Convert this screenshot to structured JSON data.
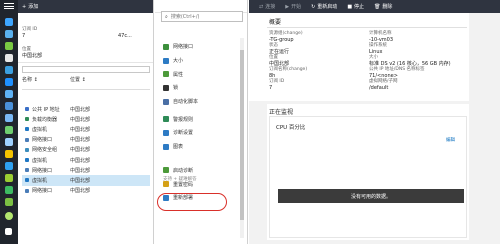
{
  "colors": {
    "accent": "#0a6fbf",
    "nav_bg": "#20252d",
    "toolbar_bg": "#2f3440",
    "selected_row": "#cde6f7",
    "highlight": "#d9302a"
  },
  "blade1": {
    "toolbar": {
      "add": "添加",
      "refresh": ""
    },
    "header": {
      "sub_id_label": "订阅 ID",
      "sub_id_value": "7",
      "sub_id_tail": "47c...",
      "location_label": "位置",
      "location_value": "中国北部"
    },
    "filter_placeholder": "",
    "columns": {
      "name": "名称",
      "location": "位置"
    },
    "rows": [
      {
        "name": "公共 IP 地址",
        "location": "中国北部",
        "icon": "ip-icon",
        "color": "#3b6fc7"
      },
      {
        "name": "负载均衡器",
        "location": "中国北部",
        "icon": "lb-icon",
        "color": "#2e8b57"
      },
      {
        "name": "虚拟机",
        "location": "中国北部",
        "icon": "vm-icon",
        "color": "#1f77c4"
      },
      {
        "name": "网络接口",
        "location": "中国北部",
        "icon": "nic-icon",
        "color": "#4a7db8"
      },
      {
        "name": "网络安全组",
        "location": "中国北部",
        "icon": "nsg-icon",
        "color": "#3c8dbc"
      },
      {
        "name": "虚拟机",
        "location": "中国北部",
        "icon": "vm-icon",
        "color": "#1f77c4"
      },
      {
        "name": "网络接口",
        "location": "中国北部",
        "icon": "nic-icon",
        "color": "#4a7db8"
      },
      {
        "name": "虚拟机",
        "location": "中国北部",
        "icon": "vm-icon",
        "color": "#1f77c4"
      },
      {
        "name": "网络接口",
        "location": "中国北部",
        "icon": "nic-icon",
        "color": "#4a7db8"
      }
    ]
  },
  "blade2": {
    "search_placeholder": "搜索(Ctrl+/)",
    "section_support": "支持 + 疑难解答",
    "items": [
      {
        "label": "网络接口",
        "icon": "nic-icon",
        "color": "#3c8f3c"
      },
      {
        "label": "大小",
        "icon": "size-icon",
        "color": "#2d7bc4"
      },
      {
        "label": "属性",
        "icon": "properties-icon",
        "color": "#4c9a3a"
      },
      {
        "label": "锁",
        "icon": "lock-icon",
        "color": "#333"
      },
      {
        "label": "自动化脚本",
        "icon": "script-icon",
        "color": "#4a6fa5"
      },
      {
        "label": "警报规则",
        "icon": "alert-icon",
        "color": "#2e8b57"
      },
      {
        "label": "诊断设置",
        "icon": "diagnostics-icon",
        "color": "#2d7bc4"
      },
      {
        "label": "图表",
        "icon": "chart-icon",
        "color": "#2d7bc4"
      },
      {
        "label": "启动诊断",
        "icon": "boot-diagnostics-icon",
        "color": "#4c9a3a"
      },
      {
        "label": "重置密码",
        "icon": "key-icon",
        "color": "#d4a017"
      },
      {
        "label": "重新部署",
        "icon": "redeploy-icon",
        "color": "#2d7bc4"
      }
    ]
  },
  "blade3": {
    "toolbar": {
      "connect": "连接",
      "start": "开始",
      "restart": "重新启动",
      "stop": "停止",
      "delete": "删除"
    },
    "summary_title": "概要",
    "fields": {
      "rg_label": "资源组(change)",
      "rg_value": "-TG-group",
      "computer_label": "计算机名称",
      "computer_value": "-10-vm03",
      "status_label": "状态",
      "status_value": "正在运行",
      "os_label": "操作系统",
      "os_value": "Linux",
      "location_label": "位置",
      "location_value": "中国北部",
      "size_label": "大小",
      "size_value": "标准 DS v2 (16 核心，56 GB 内存)",
      "sub_label": "订阅名称(change)",
      "sub_value": "8h",
      "ip_label": "公共 IP 地址/DNS 名称标签",
      "ip_value": "71/<none>",
      "sub_id_label": "订阅 ID",
      "sub_id_value": "7",
      "vnet_label": "虚拟网络/子网",
      "vnet_value": "/default"
    },
    "monitor_title": "正在监视",
    "card_title": "CPU 百分比",
    "card_edit": "编辑",
    "no_data": "没有可用的数据。"
  }
}
